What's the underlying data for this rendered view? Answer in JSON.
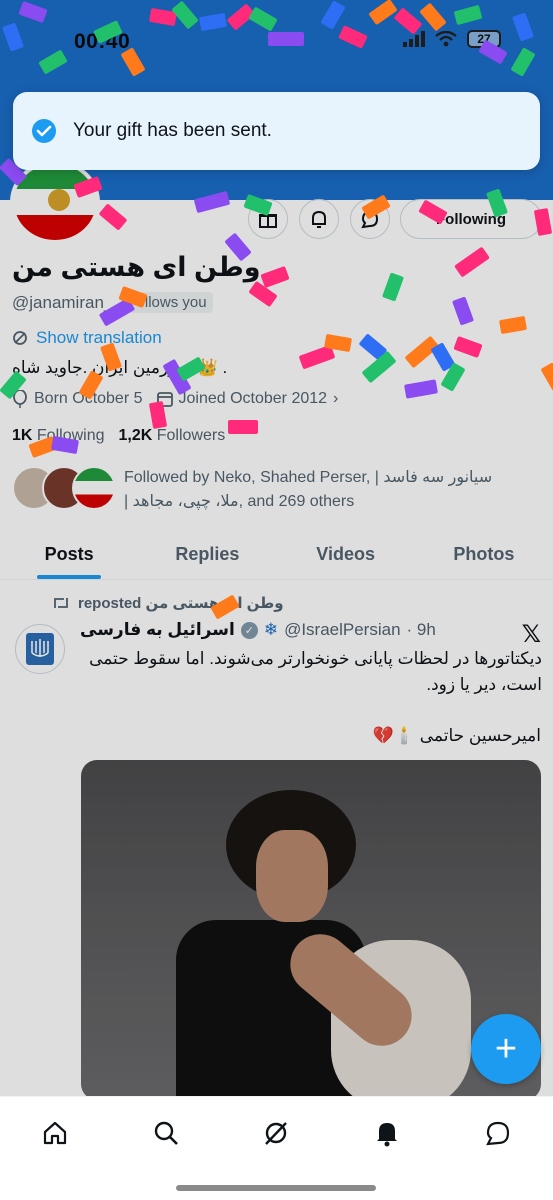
{
  "status_bar": {
    "time": "00:40",
    "battery": "27"
  },
  "toast": {
    "message": "Your gift has been sent."
  },
  "profile": {
    "name": "وطن ای هستی من",
    "handle": "@janamiran_",
    "follows_you": "Follows you",
    "show_translation": "Show translation",
    "bio": "سرزمین ایران .جاوید شاه 👑 .",
    "born": "Born October 5",
    "joined": "Joined October 2012",
    "following_count": "1K",
    "following_label": "Following",
    "followers_count": "1,2K",
    "followers_label": "Followers",
    "followed_by_line1": "Followed by Neko, Shahed Perser, | سیانور سه فاسد",
    "followed_by_line2": "| ملا، چپی، مجاهد, and 269 others",
    "follow_button": "Following"
  },
  "tabs": [
    "Posts",
    "Replies",
    "Videos",
    "Photos"
  ],
  "post": {
    "repost_label": "reposted وطن ای هستی من",
    "author_name": "اسرائیل به فارسی",
    "author_handle": "@IsraelPersian",
    "time": "· 9h",
    "text": "دیکتاتورها در لحظات پایانی خونخوارتر می‌شوند. اما سقوط حتمی است، دیر یا زود.",
    "signature": "امیرحسین حاتمی 🕯️💔"
  },
  "fab_label": "+",
  "icons": {
    "home": "home-icon",
    "search": "search-icon",
    "grok": "grok-icon",
    "notifications": "bell-icon",
    "messages": "message-icon"
  },
  "colors": {
    "accent": "#1d9bf0",
    "banner": "#1b6ec9"
  }
}
